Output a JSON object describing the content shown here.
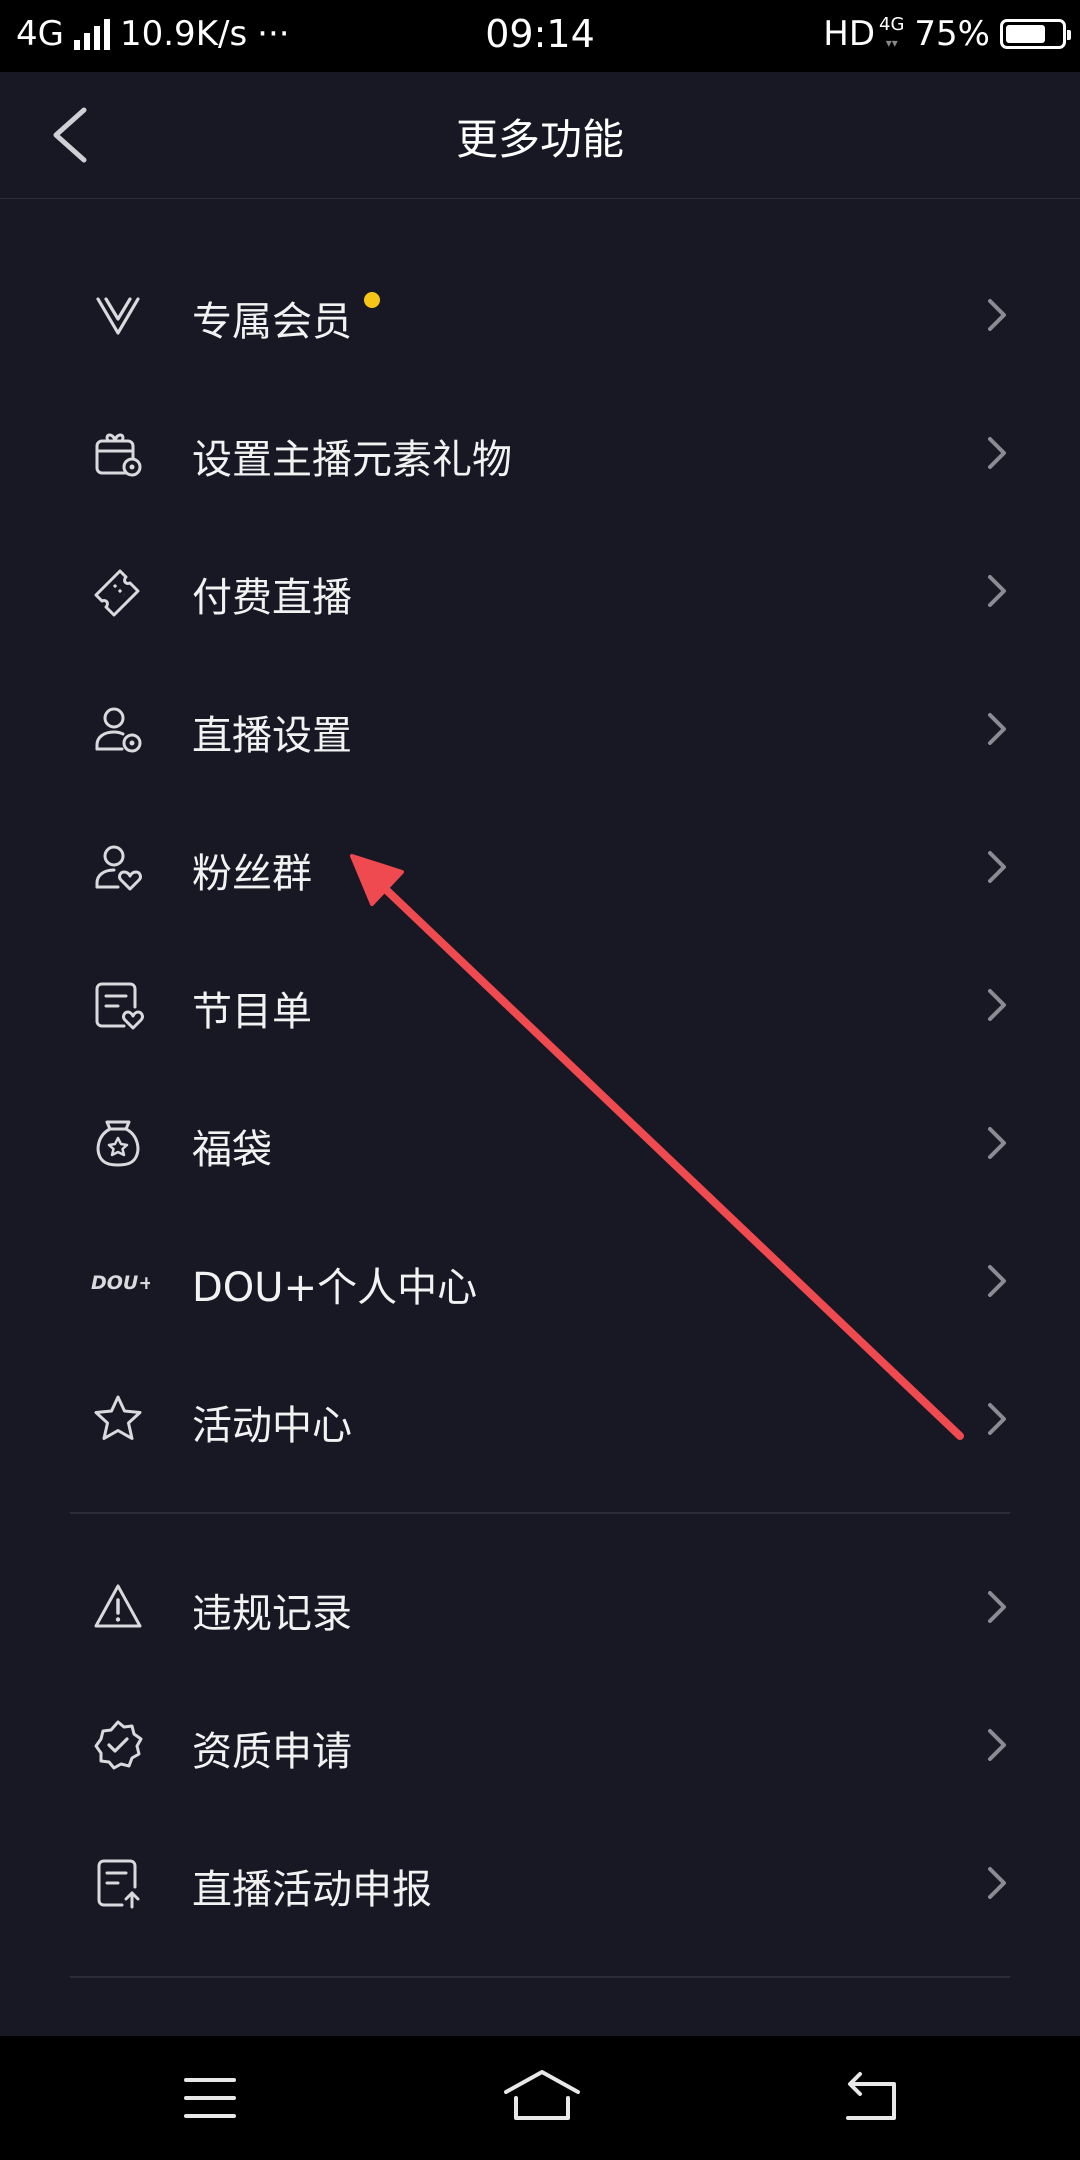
{
  "status_bar": {
    "network": "4G",
    "speed": "10.9K/s",
    "more": "···",
    "time": "09:14",
    "hd": "HD",
    "net2": "4G",
    "battery": "75%",
    "battery_level": 0.75
  },
  "header": {
    "title": "更多功能"
  },
  "menu_groups": [
    {
      "items": [
        {
          "label": "专属会员",
          "icon": "vip-v-icon",
          "badge": true
        },
        {
          "label": "设置主播元素礼物",
          "icon": "gift-settings-icon"
        },
        {
          "label": "付费直播",
          "icon": "ticket-icon"
        },
        {
          "label": "直播设置",
          "icon": "user-settings-icon"
        },
        {
          "label": "粉丝群",
          "icon": "fans-group-icon"
        },
        {
          "label": "节目单",
          "icon": "program-list-icon"
        },
        {
          "label": "福袋",
          "icon": "lucky-bag-icon"
        },
        {
          "label": "DOU+个人中心",
          "icon": "dou-plus-icon",
          "icon_text": "DOU+"
        },
        {
          "label": "活动中心",
          "icon": "star-icon"
        }
      ]
    },
    {
      "items": [
        {
          "label": "违规记录",
          "icon": "warning-icon"
        },
        {
          "label": "资质申请",
          "icon": "verified-badge-icon"
        },
        {
          "label": "直播活动申报",
          "icon": "report-document-icon"
        }
      ]
    }
  ],
  "colors": {
    "background": "#171824",
    "badge": "#f5c518",
    "arrow": "#ef4a4f",
    "icon": "#d9d9de",
    "chevron": "#8a8b93"
  },
  "nav_bar": {
    "buttons": [
      "menu-icon",
      "home-icon",
      "back-icon"
    ]
  }
}
